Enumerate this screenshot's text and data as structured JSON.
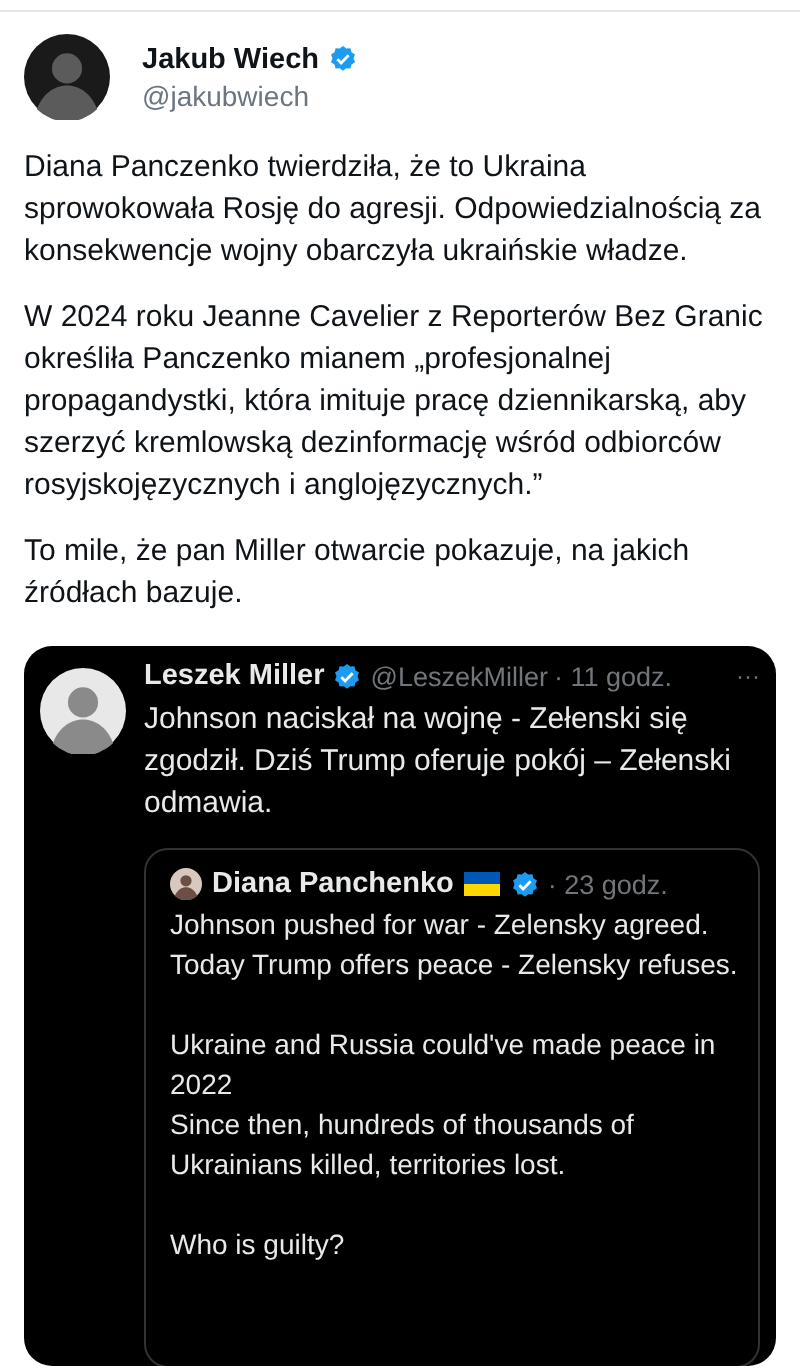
{
  "author": {
    "name": "Jakub Wiech",
    "handle": "@jakubwiech",
    "verified": true
  },
  "body": [
    "Diana Panczenko twierdziła, że to Ukraina sprowokowała Rosję do agresji. Odpowiedzialnością za konsekwencje wojny obarczyła ukraińskie władze.",
    "W 2024 roku Jeanne Cavelier z Reporterów Bez Granic określiła Panczenko mianem „profesjonalnej propagandystki, która imituje pracę dziennikarską, aby szerzyć kremlowską dezinformację wśród odbiorców rosyjskojęzycznych i anglojęzycznych.”",
    "To mile, że pan Miller otwarcie pokazuje, na jakich źródłach bazuje."
  ],
  "quote": {
    "name": "Leszek Miller",
    "verified": true,
    "handle": "@LeszekMiller",
    "time": "· 11 godz.",
    "more": "···",
    "text": "Johnson naciskał na wojnę - Zełenski się zgodził. Dziś Trump oferuje pokój – Zełenski odmawia.",
    "nested": {
      "name": "Diana Panchenko",
      "flag": true,
      "verified": true,
      "time": "· 23 godz.",
      "paragraphs": [
        [
          "Johnson pushed for war - Zelensky agreed.",
          "Today Trump offers peace - Zelensky refuses."
        ],
        [
          "Ukraine and Russia could've made peace in 2022",
          "Since then, hundreds of thousands of Ukrainians killed, territories lost."
        ],
        [
          "Who is guilty?"
        ]
      ]
    }
  }
}
